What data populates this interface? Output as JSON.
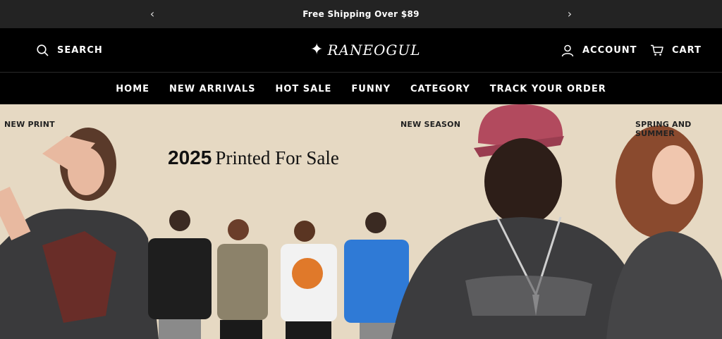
{
  "announcement": {
    "message": "Free Shipping Over $89",
    "prev_icon": "chevron-left-icon",
    "next_icon": "chevron-right-icon"
  },
  "header": {
    "search_label": "SEARCH",
    "logo_text": "RANEOGUL",
    "account_label": "ACCOUNT",
    "cart_label": "CART"
  },
  "nav": {
    "items": [
      {
        "label": "HOME"
      },
      {
        "label": "NEW ARRIVALS"
      },
      {
        "label": "HOT SALE"
      },
      {
        "label": "FUNNY"
      },
      {
        "label": "CATEGORY"
      },
      {
        "label": "TRACK YOUR ORDER"
      }
    ]
  },
  "hero": {
    "tag_left": "NEW PRINT",
    "tag_middle": "NEW SEASON",
    "tag_right": "SPRING AND SUMMER",
    "headline_year": "2025",
    "headline_rest": "Printed For Sale"
  },
  "colors": {
    "announce_bg": "#232323",
    "header_bg": "#000000",
    "hero_bg": "#e6d9c3",
    "text_dark": "#111111"
  }
}
